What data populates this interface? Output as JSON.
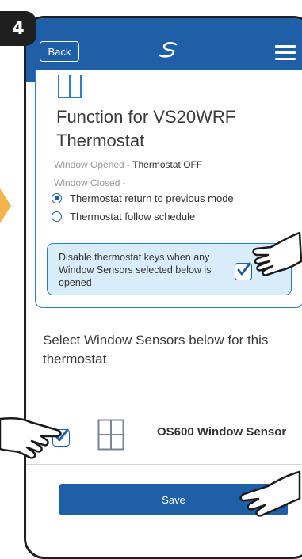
{
  "step": {
    "number": "4"
  },
  "header": {
    "back_label": "Back",
    "logo": "salus-logo-icon",
    "menu": "hamburger-menu-icon"
  },
  "function_panel": {
    "title": "Function for VS20WRF Thermostat",
    "window_opened": {
      "label": "Window Opened -",
      "value": "Thermostat OFF"
    },
    "window_closed": {
      "label": "Window Closed -"
    },
    "options": [
      {
        "label": "Thermostat return to previous mode",
        "selected": true
      },
      {
        "label": "Thermostat follow schedule",
        "selected": false
      }
    ],
    "disable_keys": {
      "label": "Disable thermostat keys when any Window Sensors selected below is opened",
      "checked": true
    }
  },
  "sensors": {
    "heading": "Select Window Sensors below for this thermostat",
    "items": [
      {
        "name": "OS600 Window Sensor",
        "checked": true,
        "icon": "window-icon"
      }
    ]
  },
  "footer": {
    "save_label": "Save"
  },
  "colors": {
    "primary": "#1e5fa8",
    "panel_border": "#2e7bd0",
    "highlight_bg": "#d9ecf9",
    "arrow": "#f1b44c"
  }
}
